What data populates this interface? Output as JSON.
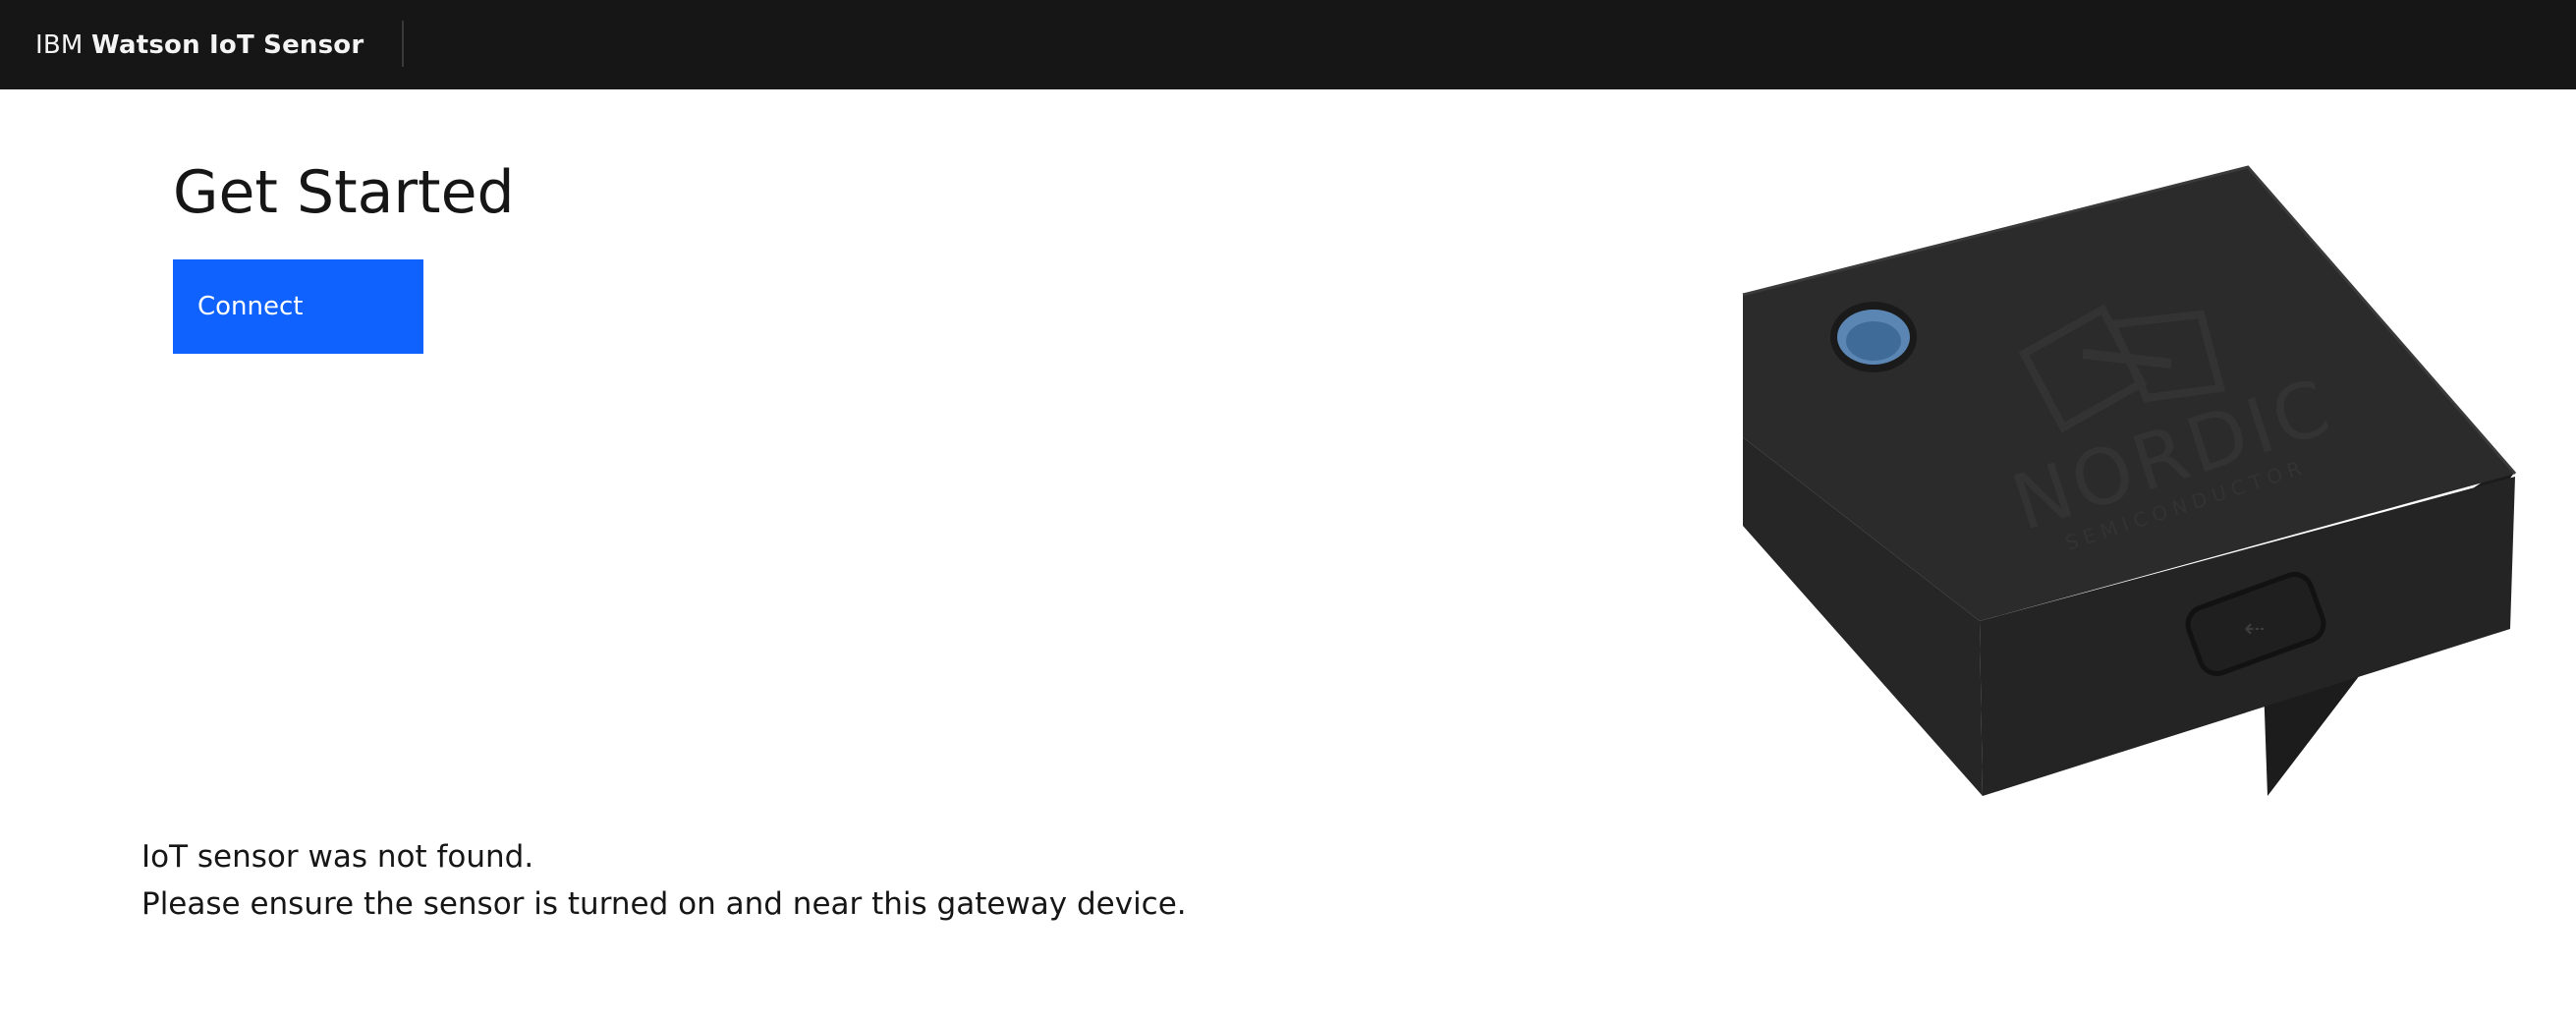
{
  "header": {
    "brand_prefix": "IBM",
    "brand_name": "Watson IoT Sensor"
  },
  "main": {
    "title": "Get Started",
    "connect_label": "Connect",
    "status_line_1": "IoT sensor was not found.",
    "status_line_2": "Please ensure the sensor is turned on and near this gateway device."
  },
  "device_image": {
    "brand_text": "NORDIC",
    "subtext": "SEMICONDUCTOR"
  },
  "colors": {
    "header_bg": "#161616",
    "button_bg": "#0f62fe",
    "device_body": "#2a2a2a"
  }
}
